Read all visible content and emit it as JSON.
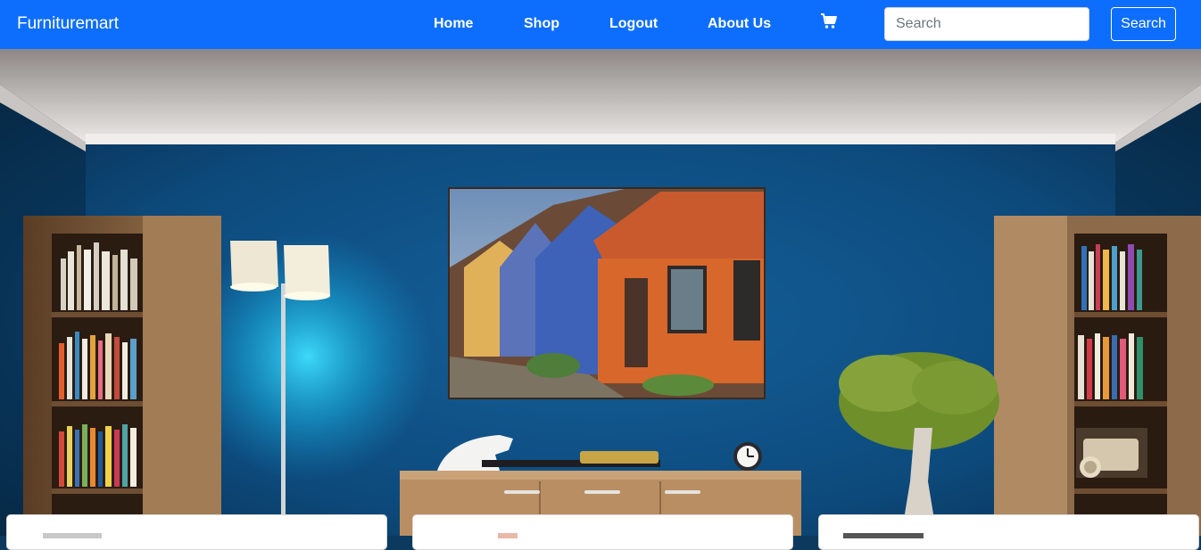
{
  "navbar": {
    "brand": "Furnituremart",
    "links": [
      {
        "label": "Home"
      },
      {
        "label": "Shop"
      },
      {
        "label": "Logout"
      },
      {
        "label": "About Us"
      }
    ],
    "cart_icon": "shopping-cart-icon",
    "search": {
      "placeholder": "Search",
      "button_label": "Search"
    },
    "colors": {
      "bar": "#0d6efd",
      "text": "#ffffff"
    }
  },
  "hero": {
    "image": "living-room-blue-wall",
    "colors": {
      "wall": "#0e4a7a",
      "ceiling": "#d9d6d4",
      "shelf": "#8a6a4a"
    }
  },
  "cards": [
    {
      "name": "product-card-1"
    },
    {
      "name": "product-card-2"
    },
    {
      "name": "product-card-3"
    }
  ]
}
